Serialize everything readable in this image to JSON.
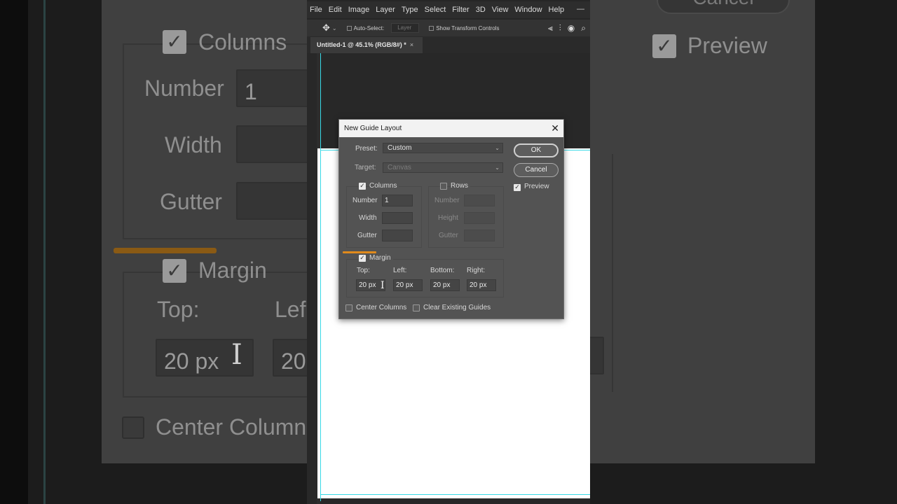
{
  "background_zoom": {
    "columns_label": "Columns",
    "number_label": "Number",
    "number_value": "1",
    "width_label": "Width",
    "gutter_label": "Gutter",
    "margin_label": "Margin",
    "top_label": "Top:",
    "left_label_partial": "Lef",
    "top_value": "20 px",
    "left_value_partial": "20",
    "center_columns_partial": "Center Column",
    "preview_label": "Preview",
    "cancel_partial": "Cancel"
  },
  "menubar": {
    "items": [
      "File",
      "Edit",
      "Image",
      "Layer",
      "Type",
      "Select",
      "Filter",
      "3D",
      "View",
      "Window",
      "Help"
    ],
    "minimize_glyph": "—"
  },
  "options_bar": {
    "auto_select_label": "Auto-Select:",
    "layer_select": "Layer",
    "show_transform_label": "Show Transform Controls"
  },
  "document_tab": {
    "title": "Untitled-1 @ 45.1% (RGB/8#) *",
    "close_glyph": "×"
  },
  "dialog": {
    "title": "New Guide Layout",
    "close_glyph": "✕",
    "preset_label": "Preset:",
    "preset_value": "Custom",
    "target_label": "Target:",
    "target_value": "Canvas",
    "ok_label": "OK",
    "cancel_label": "Cancel",
    "preview_label": "Preview",
    "preview_checked": true,
    "columns": {
      "label": "Columns",
      "checked": true,
      "number_label": "Number",
      "number_value": "1",
      "width_label": "Width",
      "width_value": "",
      "gutter_label": "Gutter",
      "gutter_value": ""
    },
    "rows": {
      "label": "Rows",
      "checked": false,
      "number_label": "Number",
      "height_label": "Height",
      "gutter_label": "Gutter"
    },
    "margin": {
      "label": "Margin",
      "checked": true,
      "top_label": "Top:",
      "left_label": "Left:",
      "bottom_label": "Bottom:",
      "right_label": "Right:",
      "top_value": "20 px",
      "left_value": "20 px",
      "bottom_value": "20 px",
      "right_value": "20 px"
    },
    "center_columns_label": "Center Columns",
    "clear_guides_label": "Clear Existing Guides"
  }
}
